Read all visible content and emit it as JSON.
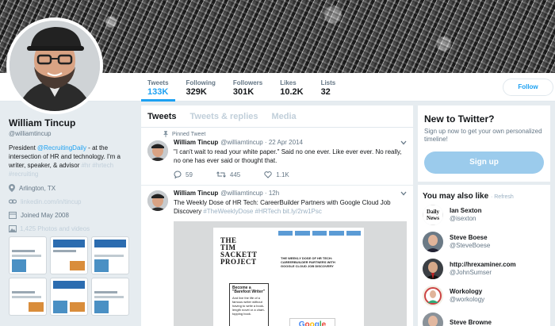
{
  "profile": {
    "name": "William Tincup",
    "handle": "@williamtincup",
    "bio_prefix": "President ",
    "bio_link": "@RecruitingDaily",
    "bio_text": " - at the intersection of HR and technology. I'm a writer, speaker, & advisor ",
    "bio_tags": "#hr #hrtech #recruiting",
    "location": "Arlington, TX",
    "website": "linkedin.com/in/tincup",
    "joined": "Joined May 2008",
    "photos": "1,425 Photos and videos"
  },
  "stats": [
    {
      "label": "Tweets",
      "value": "133K"
    },
    {
      "label": "Following",
      "value": "329K"
    },
    {
      "label": "Followers",
      "value": "301K"
    },
    {
      "label": "Likes",
      "value": "10.2K"
    },
    {
      "label": "Lists",
      "value": "32"
    }
  ],
  "follow_label": "Follow",
  "tabs": [
    "Tweets",
    "Tweets & replies",
    "Media"
  ],
  "tweets": [
    {
      "pinned_label": "Pinned Tweet",
      "name": "William Tincup",
      "handle": "@williamtincup · 22 Apr 2014",
      "text": "\"I can't wait to read your white paper.\"  Said no one ever.  Like ever ever.  No really, no one has ever said or thought that.",
      "replies": "59",
      "retweets": "445",
      "likes": "1.1K"
    },
    {
      "name": "William Tincup",
      "handle": "@williamtincup · 12h",
      "text": "The Weekly Dose of HR Tech: CareerBuilder Partners with Google Cloud Job Discovery ",
      "tags": "#TheWeeklyDose #HRTech bit.ly/2rw1Psc",
      "media": {
        "logo_line1": "THE",
        "logo_line2": "TIM",
        "logo_line3": "SACKETT",
        "logo_line4": "PROJECT",
        "headline": "THE WEEKLY DOSE OF HR TECH: CAREERBUILDER PARTNERS WITH GOOGLE CLOUD JOB DISCOVERY",
        "card_title": "Become a \"Barefoot Writer\"",
        "card_text": "And live the life of a famous writer without having to write a book-length novel or a chart-topping book.",
        "google": "Google"
      }
    }
  ],
  "signup_box": {
    "title": "New to Twitter?",
    "subtitle": "Sign up now to get your own personalized timeline!",
    "button": "Sign up"
  },
  "suggestions_box": {
    "title": "You may also like",
    "refresh": "· Refresh",
    "items": [
      {
        "name": "Ian Sexton",
        "handle": "@isexton",
        "avatar_text": "Daily News"
      },
      {
        "name": "Steve Boese",
        "handle": "@SteveBoese"
      },
      {
        "name": "http://hrexaminer.com",
        "handle": "@JohnSumser"
      },
      {
        "name": "Workology",
        "handle": "@workology"
      },
      {
        "name": "Steve Browne",
        "handle": ""
      }
    ]
  },
  "colors": {
    "accent": "#1da1f2",
    "background": "#e6ecf0",
    "signup": "#9bcbec"
  }
}
